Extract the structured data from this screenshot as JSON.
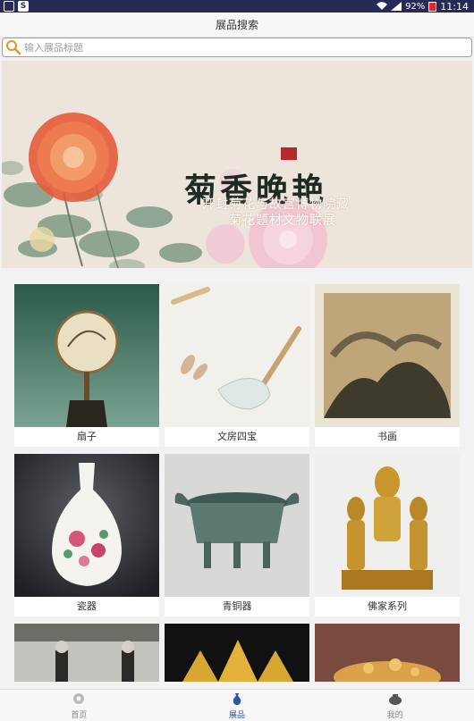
{
  "status_bar": {
    "battery": "92%",
    "time": "11:14"
  },
  "header": {
    "title": "展品搜索"
  },
  "search": {
    "placeholder": "输入展品标题"
  },
  "banner": {
    "title": "菊香晚艳",
    "subtitle_line1": "开封菊花与故宫博物院藏",
    "subtitle_line2": "菊花题材文物联展"
  },
  "categories": [
    {
      "label": "扇子"
    },
    {
      "label": "文房四宝"
    },
    {
      "label": "书画"
    },
    {
      "label": "瓷器"
    },
    {
      "label": "青铜器"
    },
    {
      "label": "佛家系列"
    }
  ],
  "tabs": [
    {
      "label": "首页",
      "icon": "home-icon",
      "active": false
    },
    {
      "label": "展品",
      "icon": "exhibits-icon",
      "active": true
    },
    {
      "label": "我的",
      "icon": "profile-icon",
      "active": false
    }
  ],
  "colors": {
    "status_bar": "#262a55",
    "accent": "#2c57a6",
    "background": "#f2f2f2"
  }
}
